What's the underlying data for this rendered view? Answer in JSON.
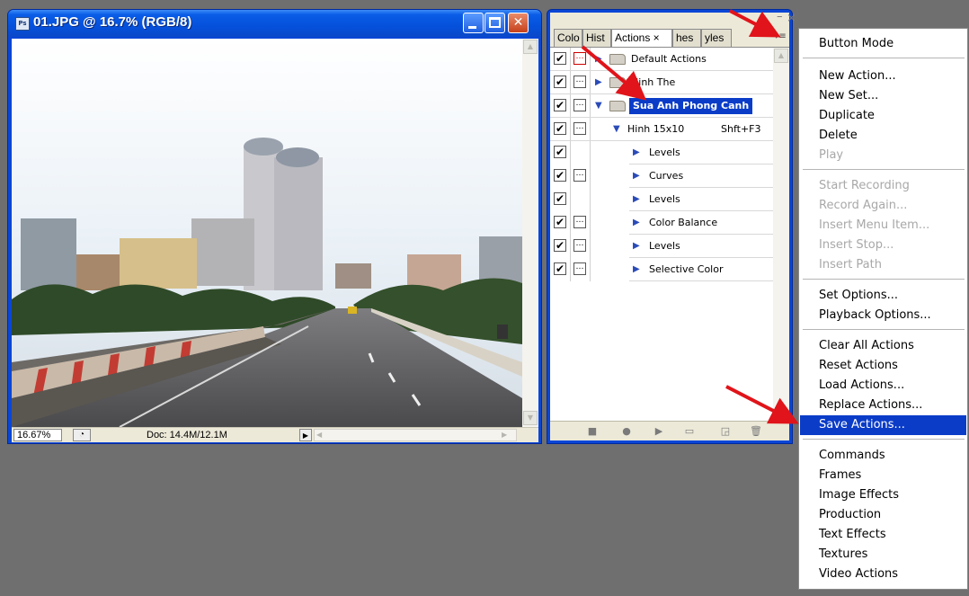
{
  "document_window": {
    "title": "01.JPG @ 16.7% (RGB/8)",
    "icon_label": "Ps",
    "zoom": "16.67%",
    "doc_info": "Doc: 14.4M/12.1M"
  },
  "panel": {
    "tabs": [
      "Colo",
      "Hist",
      "Actions ×",
      "hes",
      "yles"
    ],
    "active_tab": "Actions",
    "rows": [
      {
        "label": "Default Actions",
        "checked": true,
        "dialog": "red",
        "expanded": false
      },
      {
        "label": "Hinh The",
        "checked": true,
        "dialog": "normal",
        "expanded": false
      },
      {
        "label": "Sua Anh Phong Canh",
        "checked": true,
        "dialog": "normal",
        "expanded": true,
        "selected": true
      },
      {
        "label": "Hinh 15x10",
        "shortcut": "Shft+F3",
        "checked": true,
        "dialog": "normal",
        "expanded": true
      },
      {
        "label": "Levels",
        "checked": true,
        "dialog": "none"
      },
      {
        "label": "Curves",
        "checked": true,
        "dialog": "normal"
      },
      {
        "label": "Levels",
        "checked": true,
        "dialog": "none"
      },
      {
        "label": "Color Balance",
        "checked": true,
        "dialog": "normal"
      },
      {
        "label": "Levels",
        "checked": true,
        "dialog": "normal"
      },
      {
        "label": "Selective Color",
        "checked": true,
        "dialog": "normal"
      }
    ],
    "footer_icons": [
      "stop-icon",
      "record-icon",
      "play-icon",
      "new-set-icon",
      "new-action-icon",
      "delete-icon"
    ]
  },
  "menu": {
    "items": [
      {
        "label": "Button Mode",
        "state": "enabled"
      },
      {
        "sep": true
      },
      {
        "label": "New Action...",
        "state": "enabled"
      },
      {
        "label": "New Set...",
        "state": "enabled"
      },
      {
        "label": "Duplicate",
        "state": "enabled"
      },
      {
        "label": "Delete",
        "state": "enabled"
      },
      {
        "label": "Play",
        "state": "disabled"
      },
      {
        "sep": true
      },
      {
        "label": "Start Recording",
        "state": "disabled"
      },
      {
        "label": "Record Again...",
        "state": "disabled"
      },
      {
        "label": "Insert Menu Item...",
        "state": "disabled"
      },
      {
        "label": "Insert Stop...",
        "state": "disabled"
      },
      {
        "label": "Insert Path",
        "state": "disabled"
      },
      {
        "sep": true
      },
      {
        "label": "Set Options...",
        "state": "enabled"
      },
      {
        "label": "Playback Options...",
        "state": "enabled"
      },
      {
        "sep": true
      },
      {
        "label": "Clear All Actions",
        "state": "enabled"
      },
      {
        "label": "Reset Actions",
        "state": "enabled"
      },
      {
        "label": "Load Actions...",
        "state": "enabled"
      },
      {
        "label": "Replace Actions...",
        "state": "enabled"
      },
      {
        "label": "Save Actions...",
        "state": "highlighted"
      },
      {
        "sep": true
      },
      {
        "label": "Commands",
        "state": "enabled"
      },
      {
        "label": "Frames",
        "state": "enabled"
      },
      {
        "label": "Image Effects",
        "state": "enabled"
      },
      {
        "label": "Production",
        "state": "enabled"
      },
      {
        "label": "Text Effects",
        "state": "enabled"
      },
      {
        "label": "Textures",
        "state": "enabled"
      },
      {
        "label": "Video Actions",
        "state": "enabled"
      }
    ]
  },
  "colors": {
    "xp_blue": "#0a46d6",
    "selection": "#0a3cc8",
    "annotation_arrow": "#e0141a",
    "desktop": "#6f6f6f"
  }
}
